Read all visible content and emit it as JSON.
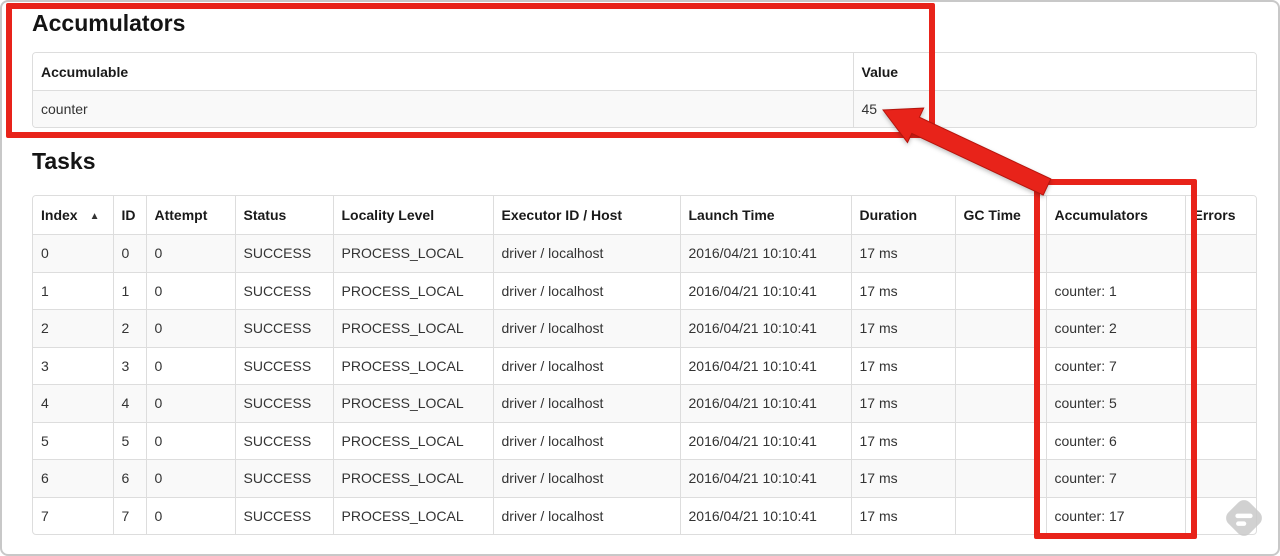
{
  "colors": {
    "annotation_red": "#e8231a",
    "table_border": "#dddddd",
    "row_stripe": "#f9f9f9",
    "page_border": "#c8c8c8"
  },
  "accumulators_section": {
    "title": "Accumulators",
    "table": {
      "columns": [
        "Accumulable",
        "Value"
      ],
      "rows": [
        {
          "accumulable": "counter",
          "value": "45"
        }
      ]
    }
  },
  "tasks_section": {
    "title": "Tasks",
    "table": {
      "columns": [
        "Index",
        "ID",
        "Attempt",
        "Status",
        "Locality Level",
        "Executor ID / Host",
        "Launch Time",
        "Duration",
        "GC Time",
        "Accumulators",
        "Errors"
      ],
      "sorted_by": "Index",
      "sort_direction": "ascending",
      "sort_indicator": "▲",
      "rows": [
        {
          "index": "0",
          "id": "0",
          "attempt": "0",
          "status": "SUCCESS",
          "locality_level": "PROCESS_LOCAL",
          "executor_id_host": "driver / localhost",
          "launch_time": "2016/04/21 10:10:41",
          "duration": "17 ms",
          "gc_time": "",
          "accumulators": "",
          "errors": ""
        },
        {
          "index": "1",
          "id": "1",
          "attempt": "0",
          "status": "SUCCESS",
          "locality_level": "PROCESS_LOCAL",
          "executor_id_host": "driver / localhost",
          "launch_time": "2016/04/21 10:10:41",
          "duration": "17 ms",
          "gc_time": "",
          "accumulators": "counter: 1",
          "errors": ""
        },
        {
          "index": "2",
          "id": "2",
          "attempt": "0",
          "status": "SUCCESS",
          "locality_level": "PROCESS_LOCAL",
          "executor_id_host": "driver / localhost",
          "launch_time": "2016/04/21 10:10:41",
          "duration": "17 ms",
          "gc_time": "",
          "accumulators": "counter: 2",
          "errors": ""
        },
        {
          "index": "3",
          "id": "3",
          "attempt": "0",
          "status": "SUCCESS",
          "locality_level": "PROCESS_LOCAL",
          "executor_id_host": "driver / localhost",
          "launch_time": "2016/04/21 10:10:41",
          "duration": "17 ms",
          "gc_time": "",
          "accumulators": "counter: 7",
          "errors": ""
        },
        {
          "index": "4",
          "id": "4",
          "attempt": "0",
          "status": "SUCCESS",
          "locality_level": "PROCESS_LOCAL",
          "executor_id_host": "driver / localhost",
          "launch_time": "2016/04/21 10:10:41",
          "duration": "17 ms",
          "gc_time": "",
          "accumulators": "counter: 5",
          "errors": ""
        },
        {
          "index": "5",
          "id": "5",
          "attempt": "0",
          "status": "SUCCESS",
          "locality_level": "PROCESS_LOCAL",
          "executor_id_host": "driver / localhost",
          "launch_time": "2016/04/21 10:10:41",
          "duration": "17 ms",
          "gc_time": "",
          "accumulators": "counter: 6",
          "errors": ""
        },
        {
          "index": "6",
          "id": "6",
          "attempt": "0",
          "status": "SUCCESS",
          "locality_level": "PROCESS_LOCAL",
          "executor_id_host": "driver / localhost",
          "launch_time": "2016/04/21 10:10:41",
          "duration": "17 ms",
          "gc_time": "",
          "accumulators": "counter: 7",
          "errors": ""
        },
        {
          "index": "7",
          "id": "7",
          "attempt": "0",
          "status": "SUCCESS",
          "locality_level": "PROCESS_LOCAL",
          "executor_id_host": "driver / localhost",
          "launch_time": "2016/04/21 10:10:41",
          "duration": "17 ms",
          "gc_time": "",
          "accumulators": "counter: 17",
          "errors": ""
        }
      ]
    }
  }
}
